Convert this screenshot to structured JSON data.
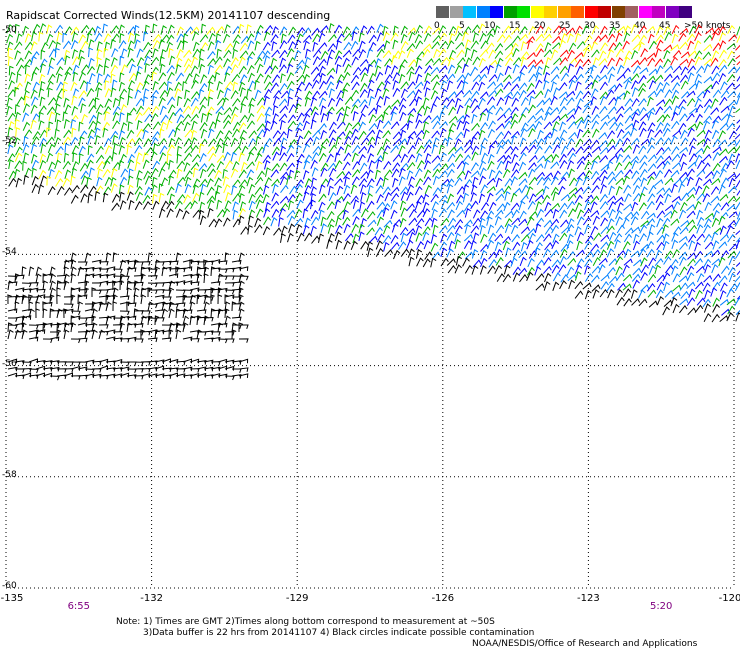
{
  "title": "Rapidscat Corrected Winds(12.5KM) 20141107 descending",
  "colorbar": {
    "labels": [
      "0",
      "5",
      "10",
      "15",
      "20",
      "25",
      "30",
      "35",
      "40",
      "45",
      ">50 knots"
    ],
    "colors": [
      "#606060",
      "#a0a0a0",
      "#00c0ff",
      "#0080ff",
      "#0000ff",
      "#00a000",
      "#00e000",
      "#ffff00",
      "#ffd000",
      "#ffa000",
      "#ff6000",
      "#ff0000",
      "#c00000",
      "#804000",
      "#a06060",
      "#ff00ff",
      "#c000c0",
      "#8000c0",
      "#400080"
    ]
  },
  "map": {
    "lon_range": [
      -135,
      -120
    ],
    "lat_range": [
      -50,
      -60
    ],
    "x_ticks": [
      "-135",
      "-132",
      "-129",
      "-126",
      "-123",
      "-120"
    ],
    "y_ticks": [
      "-50",
      "-52",
      "-54",
      "-56",
      "-58",
      "-60"
    ],
    "times": [
      {
        "label": "6:55",
        "lon": -133.5
      },
      {
        "label": "5:20",
        "lon": -121.5
      }
    ],
    "wind_colors": {
      "calm": "#000000",
      "moderate": "#0000ff",
      "fresh": "#0080ff",
      "strong": "#00b000",
      "gale": "#ffff00",
      "storm": "#ff0000"
    }
  },
  "notes": {
    "line1": "Note: 1) Times are GMT 2)Times along bottom correspond to measurement at ~50S",
    "line2": "3)Data buffer is 22 hrs from 20141107 4) Black circles indicate possible contamination",
    "credit": "NOAA/NESDIS/Office of Research and Applications"
  }
}
